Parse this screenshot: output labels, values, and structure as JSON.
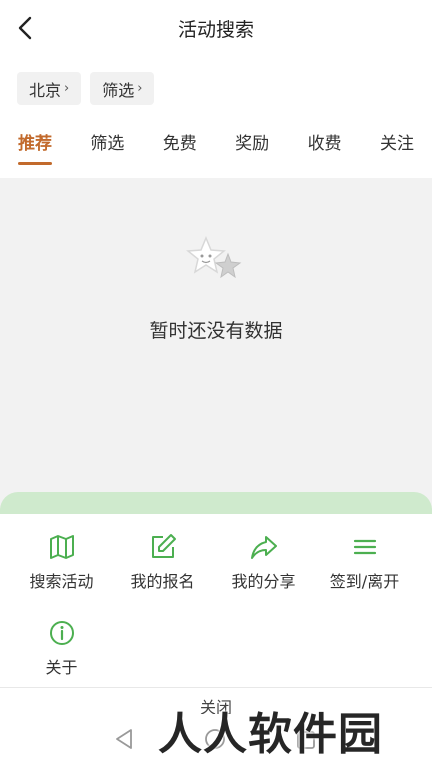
{
  "header": {
    "title": "活动搜索",
    "back_icon": "chevron-left-icon"
  },
  "filters": {
    "city": "北京",
    "filter": "筛选",
    "arrow": "›"
  },
  "tabs": [
    {
      "label": "推荐",
      "active": true
    },
    {
      "label": "筛选",
      "active": false
    },
    {
      "label": "免费",
      "active": false
    },
    {
      "label": "奖励",
      "active": false
    },
    {
      "label": "收费",
      "active": false
    },
    {
      "label": "关注",
      "active": false
    }
  ],
  "empty_state": {
    "message": "暂时还没有数据",
    "icon": "stars-icon"
  },
  "menu": {
    "items": [
      {
        "label": "搜索活动",
        "icon": "map-icon"
      },
      {
        "label": "我的报名",
        "icon": "edit-icon"
      },
      {
        "label": "我的分享",
        "icon": "share-icon"
      },
      {
        "label": "签到/离开",
        "icon": "menu-lines-icon"
      },
      {
        "label": "关于",
        "icon": "info-icon"
      }
    ],
    "close_label": "关闭"
  },
  "watermark": "人人软件园",
  "colors": {
    "accent": "#c26a2c",
    "icon_green": "#4caf50",
    "sheet_green": "#cfeacd",
    "content_bg": "#f2f2f2"
  }
}
